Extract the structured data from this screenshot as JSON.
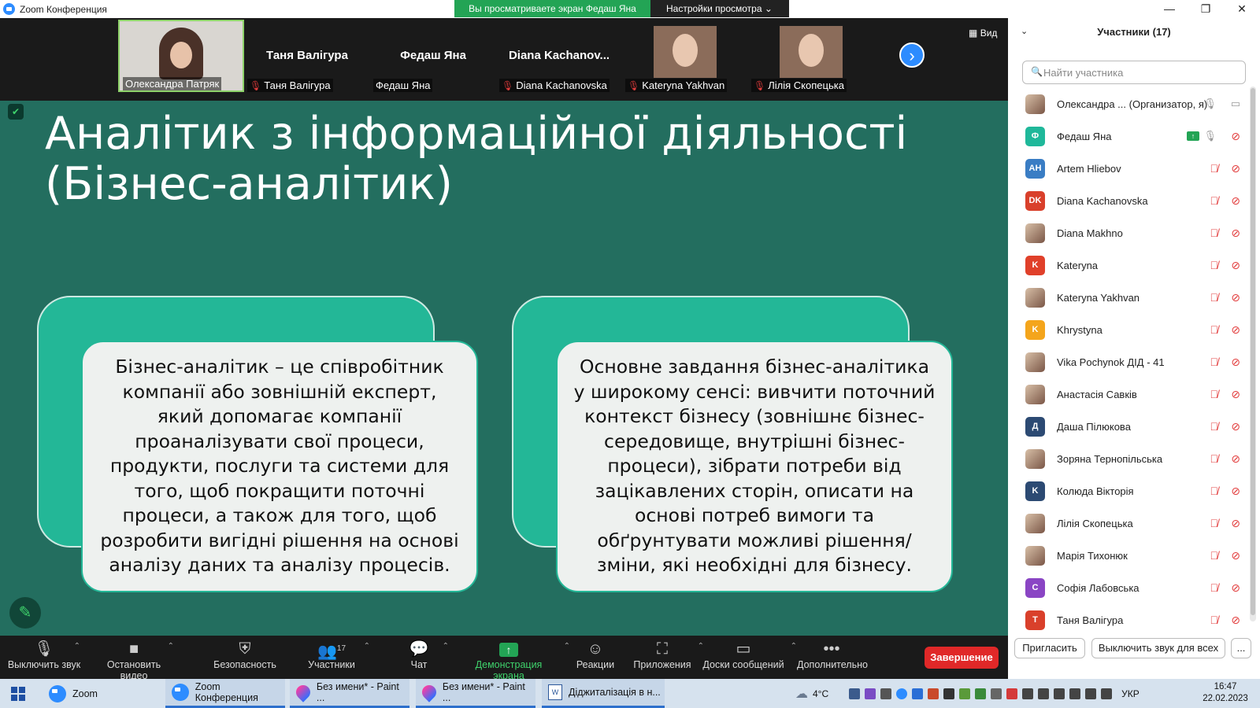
{
  "window": {
    "title": "Zoom Конференция",
    "banner": "Вы просматриваете экран Федаш Яна",
    "view_settings": "Настройки просмотра",
    "view_button": "Вид"
  },
  "video_tiles": [
    {
      "label": "Олександра Патряк",
      "name": "",
      "muted": false,
      "kind": "face"
    },
    {
      "label": "Таня Валігура",
      "name": "Таня Валігура",
      "muted": true,
      "kind": "text"
    },
    {
      "label": "Федаш Яна",
      "name": "Федаш Яна",
      "muted": false,
      "kind": "text"
    },
    {
      "label": "Diana Kachanovska",
      "name": "Diana  Kachanov...",
      "muted": true,
      "kind": "text"
    },
    {
      "label": "Kateryna Yakhvan",
      "name": "",
      "muted": true,
      "kind": "photo"
    },
    {
      "label": "Лілія Скопецька",
      "name": "",
      "muted": true,
      "kind": "photo"
    }
  ],
  "slide": {
    "title": "Аналітик з інформаційної діяльності (Бізнес-аналітик)",
    "card_left": "Бізнес-аналітик – це співробітник компанії або зовнішній експерт, який допомагає компанії проаналізувати свої процеси, продукти, послуги та системи для того, щоб покращити поточні процеси, а також для того, щоб розробити вигідні рішення на основі аналізу даних та аналізу процесів.",
    "card_right": "Основне завдання бізнес-аналітика у широкому сенсі: вивчити поточний контекст бізнесу (зовнішнє бізнес-середовище, внутрішні бізнес-процеси), зібрати потреби від зацікавлених сторін, описати на основі потреб вимоги та обґрунтувати можливі рішення/зміни, які необхідні для бізнесу."
  },
  "toolbar": {
    "mute": "Выключить звук",
    "video": "Остановить видео",
    "security": "Безопасность",
    "participants": "Участники",
    "participants_count": "17",
    "chat": "Чат",
    "share": "Демонстрация экрана",
    "reactions": "Реакции",
    "apps": "Приложения",
    "whiteboards": "Доски сообщений",
    "more": "Дополнительно",
    "end": "Завершение"
  },
  "panel": {
    "title": "Участники (17)",
    "search_placeholder": "Найти участника",
    "invite": "Пригласить",
    "mute_all": "Выключить звук для всех",
    "more": "...",
    "participants": [
      {
        "name": "Олександра ... (Организатор, я)",
        "initials": "",
        "color": "",
        "photo": true,
        "muted": false,
        "cam": true
      },
      {
        "name": "Федаш Яна",
        "initials": "Ф",
        "color": "#1fb89a",
        "photo": false,
        "muted": false,
        "cam": false,
        "sharing": true
      },
      {
        "name": "Artem Hliebov",
        "initials": "AH",
        "color": "#3a7dc4",
        "photo": false,
        "muted": true,
        "cam": false
      },
      {
        "name": "Diana Kachanovska",
        "initials": "DK",
        "color": "#d9402b",
        "photo": false,
        "muted": true,
        "cam": false
      },
      {
        "name": "Diana Makhno",
        "initials": "",
        "color": "",
        "photo": true,
        "muted": true,
        "cam": false
      },
      {
        "name": "Kateryna",
        "initials": "K",
        "color": "#e0402a",
        "photo": false,
        "muted": true,
        "cam": false
      },
      {
        "name": "Kateryna Yakhvan",
        "initials": "",
        "color": "",
        "photo": true,
        "muted": true,
        "cam": false
      },
      {
        "name": "Khrystyna",
        "initials": "K",
        "color": "#f4a51c",
        "photo": false,
        "muted": true,
        "cam": false
      },
      {
        "name": "Vika Pochynok ДІД - 41",
        "initials": "",
        "color": "",
        "photo": true,
        "muted": true,
        "cam": false
      },
      {
        "name": "Анастасія Савків",
        "initials": "",
        "color": "",
        "photo": true,
        "muted": true,
        "cam": false
      },
      {
        "name": "Даша Пілюкова",
        "initials": "Д",
        "color": "#2c4a73",
        "photo": false,
        "muted": true,
        "cam": false
      },
      {
        "name": "Зоряна Тернопільська",
        "initials": "",
        "color": "",
        "photo": true,
        "muted": true,
        "cam": false
      },
      {
        "name": "Колюда Вікторія",
        "initials": "K",
        "color": "#2c4a73",
        "photo": false,
        "muted": true,
        "cam": false
      },
      {
        "name": "Лілія Скопецька",
        "initials": "",
        "color": "",
        "photo": true,
        "muted": true,
        "cam": false
      },
      {
        "name": "Марія Тихонюк",
        "initials": "",
        "color": "",
        "photo": true,
        "muted": true,
        "cam": false
      },
      {
        "name": "Софія Лабовська",
        "initials": "С",
        "color": "#8a45c4",
        "photo": false,
        "muted": true,
        "cam": false
      },
      {
        "name": "Таня Валігура",
        "initials": "Т",
        "color": "#d9402b",
        "photo": false,
        "muted": true,
        "cam": false
      }
    ]
  },
  "taskbar": {
    "items": [
      "Zoom",
      "Zoom Конференция",
      "Без имени* - Paint ...",
      "Без имени* - Paint ...",
      "Діджиталізація в н..."
    ],
    "weather": "4°C",
    "lang": "УКР",
    "time": "16:47",
    "date": "22.02.2023"
  }
}
